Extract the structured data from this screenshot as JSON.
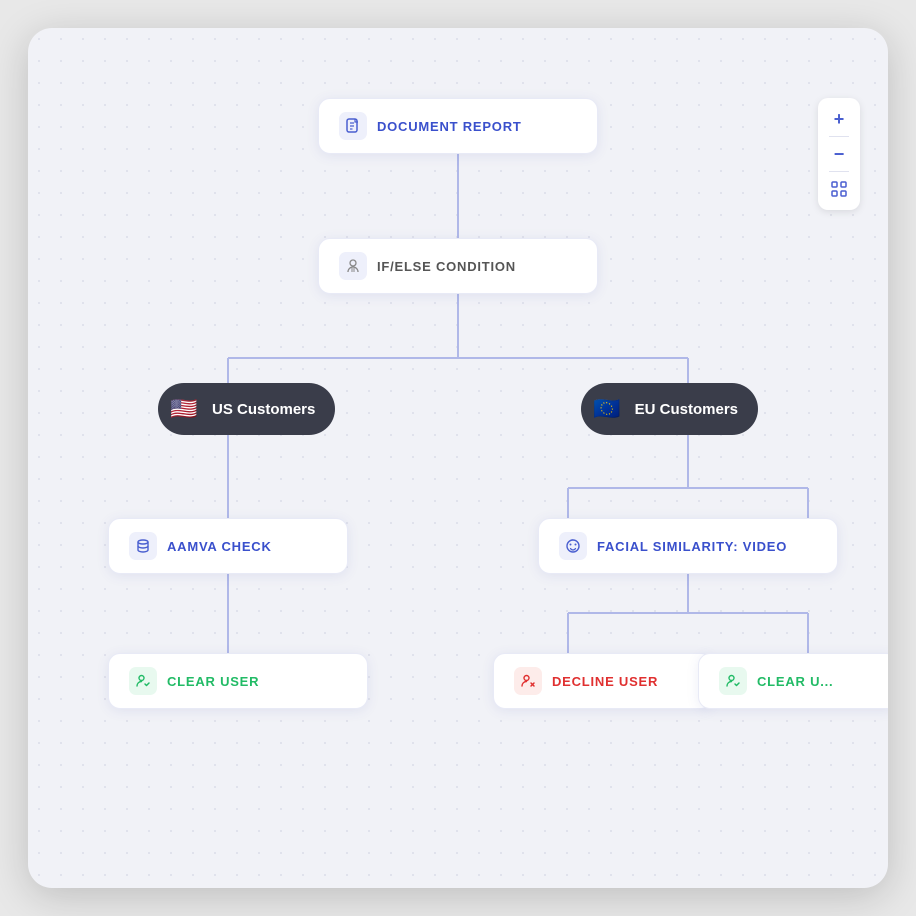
{
  "canvas": {
    "background": "#f1f2f7"
  },
  "zoom_controls": {
    "plus": "+",
    "minus": "−",
    "fit": "⛶"
  },
  "nodes": {
    "document_report": {
      "label": "DOCUMENT REPORT",
      "icon": "document-icon"
    },
    "ifelse": {
      "label": "IF/ELSE CONDITION",
      "icon": "condition-icon"
    },
    "us_customers": {
      "label": "US Customers",
      "flag": "🇺🇸"
    },
    "eu_customers": {
      "label": "EU Customers",
      "flag": "🇪🇺"
    },
    "aamva_check": {
      "label": "AAMVA CHECK",
      "icon": "database-icon"
    },
    "facial_similarity": {
      "label": "FACIAL SIMILARITY: VIDEO",
      "icon": "face-icon"
    },
    "clear_user_left": {
      "label": "CLEAR USER",
      "icon": "check-user-icon"
    },
    "decline_user": {
      "label": "DECLINE USER",
      "icon": "decline-user-icon"
    },
    "clear_user_right": {
      "label": "CLEAR U...",
      "icon": "check-user-icon"
    }
  }
}
